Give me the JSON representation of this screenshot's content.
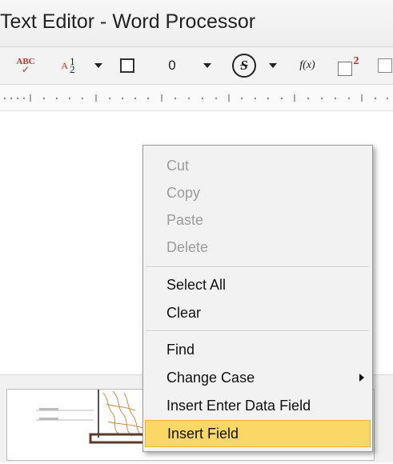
{
  "window": {
    "title": "Text Editor - Word Processor"
  },
  "toolbar": {
    "spell_icon_text": "ABC",
    "sort_letter": "A",
    "sort_num": "1",
    "sort_den": "2",
    "size_value": "0",
    "strike_letter": "S",
    "function_label": "f(x)",
    "superscript_mark": "2",
    "icons": [
      "spell-check-icon",
      "sort-icon",
      "border-icon",
      "strikethrough-icon",
      "function-icon",
      "superscript-icon"
    ]
  },
  "context_menu": {
    "cut": "Cut",
    "copy": "Copy",
    "paste": "Paste",
    "delete": "Delete",
    "select_all": "Select All",
    "clear": "Clear",
    "find": "Find",
    "change_case": "Change Case",
    "insert_enter_data_field": "Insert Enter Data Field",
    "insert_field": "Insert Field"
  },
  "colors": {
    "highlight": "#fbd865",
    "disabled_text": "#9c9c9c",
    "accent_red": "#c0302a"
  }
}
